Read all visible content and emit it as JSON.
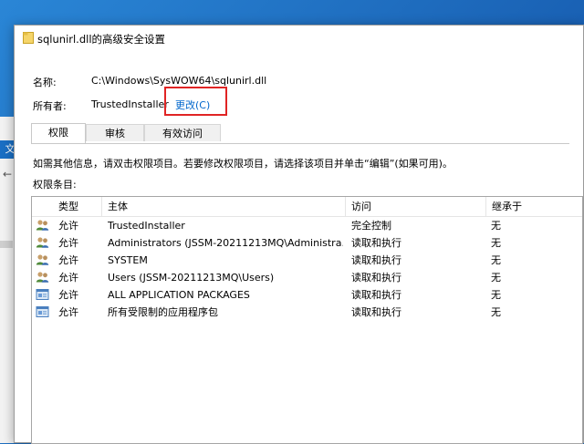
{
  "background": {
    "side_tab": "文",
    "back_arrow": "←"
  },
  "dialog": {
    "title": "sqlunirl.dll的高级安全设置",
    "name_label": "名称:",
    "name_value": "C:\\Windows\\SysWOW64\\sqlunirl.dll",
    "owner_label": "所有者:",
    "owner_value": "TrustedInstaller",
    "change_link": "更改(C)",
    "tabs": [
      {
        "label": "权限",
        "active": true
      },
      {
        "label": "审核",
        "active": false
      },
      {
        "label": "有效访问",
        "active": false
      }
    ],
    "info_text": "如需其他信息，请双击权限项目。若要修改权限项目，请选择该项目并单击“编辑”(如果可用)。",
    "entries_label": "权限条目:",
    "columns": [
      "类型",
      "主体",
      "访问",
      "继承于"
    ],
    "rows": [
      {
        "icon": "users-icon",
        "type": "允许",
        "principal": "TrustedInstaller",
        "access": "完全控制",
        "inherited": "无"
      },
      {
        "icon": "users-icon",
        "type": "允许",
        "principal": "Administrators (JSSM-20211213MQ\\Administra...",
        "access": "读取和执行",
        "inherited": "无"
      },
      {
        "icon": "users-icon",
        "type": "允许",
        "principal": "SYSTEM",
        "access": "读取和执行",
        "inherited": "无"
      },
      {
        "icon": "users-icon",
        "type": "允许",
        "principal": "Users (JSSM-20211213MQ\\Users)",
        "access": "读取和执行",
        "inherited": "无"
      },
      {
        "icon": "app-package-icon",
        "type": "允许",
        "principal": "ALL APPLICATION PACKAGES",
        "access": "读取和执行",
        "inherited": "无"
      },
      {
        "icon": "app-package-icon",
        "type": "允许",
        "principal": "所有受限制的应用程序包",
        "access": "读取和执行",
        "inherited": "无"
      }
    ]
  },
  "colors": {
    "highlight_box": "#e02424",
    "link": "#0066cc",
    "desktop": "#1f6fc0"
  }
}
